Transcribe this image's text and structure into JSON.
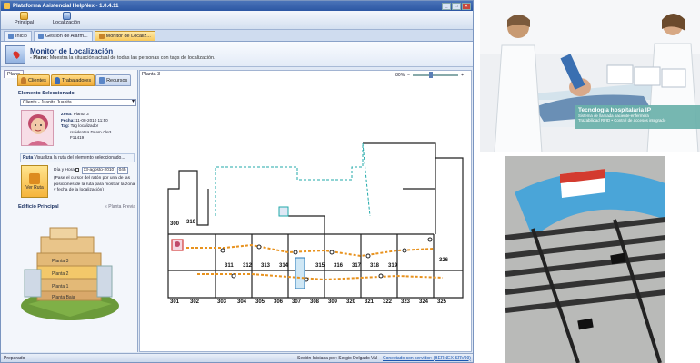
{
  "window": {
    "title": "Plataforma Asistencial HelpNex - 1.0.4.11",
    "controls": [
      "_",
      "□",
      "×"
    ]
  },
  "ribbon": {
    "items": [
      {
        "label": "Principal"
      },
      {
        "label": "Localización"
      }
    ]
  },
  "doc_tabs": [
    {
      "label": "Inicio"
    },
    {
      "label": "Gestión de Alarm..."
    },
    {
      "label": "Monitor de Localiz...",
      "active": true
    }
  ],
  "header": {
    "title": "Monitor de Localización",
    "desc_label": "- Plano:",
    "desc_text": "Muestra la situación actual de todas las personas con tags de localización."
  },
  "left_panel": {
    "plano_tab": "Plano",
    "categories": [
      "Clientes",
      "Trabajadores",
      "Recursos"
    ],
    "selected_header": "Elemento Seleccionado",
    "selected_value": "Cliente - Juanita Juanita",
    "info": [
      {
        "k": "Zona:",
        "v": "Planta 3"
      },
      {
        "k": "Fecha:",
        "v": "11-08-2010 11:50"
      },
      {
        "k": "Tag:",
        "v": "Tag localizador"
      },
      {
        "k": "",
        "v": "residentes Room Alert"
      },
      {
        "k": "",
        "v": "F11419"
      }
    ],
    "ruta_label": "Ruta",
    "ruta_text": "Visualiza la ruta del elemento seleccionado...",
    "ver_ruta": "Ver Ruta",
    "dia_label": "Día y Hora",
    "date_value": "13-agosto-2010",
    "time_value": "04h",
    "ruta_help": "(Pase el cursor del ratón por una de las posiciones de la ruta para mostrar la zona y fecha de la localización)",
    "building_header": "Edificio Principal",
    "building_action": "« Planta Previa",
    "floors": [
      "Planta 3",
      "Planta 2",
      "Planta 1",
      "Planta Baja"
    ]
  },
  "map": {
    "title": "Planta 3",
    "zoom": "80%",
    "room_labels": [
      "300",
      "310",
      "301",
      "302",
      "303",
      "304",
      "305",
      "306",
      "307",
      "308",
      "309",
      "311",
      "312",
      "313",
      "314",
      "315",
      "316",
      "317",
      "318",
      "319",
      "320",
      "321",
      "322",
      "323",
      "324",
      "325",
      "326"
    ]
  },
  "status": {
    "left": "Preparado",
    "session": "Sesión Iniciada por: Sergio Delgado Val",
    "connection": "Conectado con servidor: (BERNEX-SRV99)"
  },
  "ad": {
    "caption_title": "Tecnología hospitalaria IP",
    "caption_lines": [
      "Sistema de llamada paciente-enfermera",
      "Trazabilidad RFID • Control de accesos integrado"
    ]
  },
  "colors": {
    "accent": "#f5b43b",
    "brand": "#2c57a3",
    "route": "#e8921e",
    "caption": "#6ab1aa"
  }
}
